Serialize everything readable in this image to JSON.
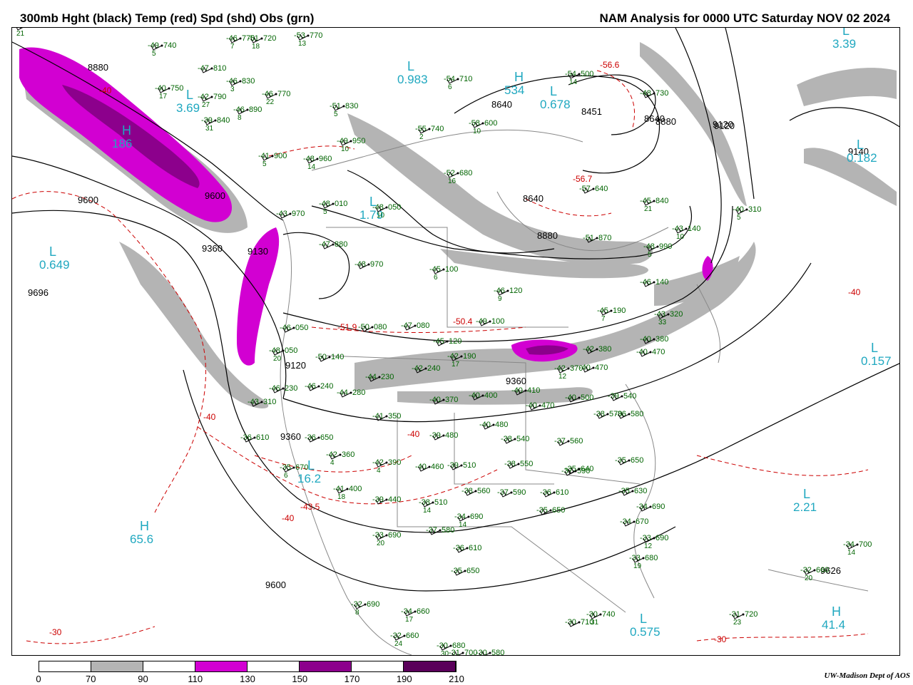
{
  "header": {
    "left_title": "300mb Hght (black) Temp (red) Spd (shd) Obs (grn)",
    "right_title": "NAM Analysis for 0000 UTC Saturday  NOV 02 2024"
  },
  "colors": {
    "height_contours": "#000000",
    "temperature_contours": "#cc0000",
    "wind_70_90": "#b4b4b4",
    "wind_110_130": "#d200d2",
    "wind_150_170": "#8c008c",
    "wind_190_210": "#5a005a",
    "obs_text": "#006400",
    "pressure_centers": "#20a8c0",
    "map_lines": "#888888"
  },
  "colorbar": {
    "labels": [
      "0",
      "70",
      "90",
      "110",
      "130",
      "150",
      "170",
      "190",
      "210"
    ],
    "segments": [
      {
        "color": "#ffffff"
      },
      {
        "color": "#b4b4b4"
      },
      {
        "color": "#ffffff"
      },
      {
        "color": "#d200d2"
      },
      {
        "color": "#ffffff"
      },
      {
        "color": "#8c008c"
      },
      {
        "color": "#ffffff"
      },
      {
        "color": "#5a005a"
      }
    ]
  },
  "height_labels": [
    "8880",
    "9600",
    "9360",
    "9130",
    "8640",
    "8451",
    "8640",
    "8880",
    "9120",
    "9140",
    "8640",
    "8880",
    "9120",
    "9360",
    "9120",
    "9600",
    "9360",
    "9600",
    "9626",
    "9696"
  ],
  "temperature_labels": [
    "-40",
    "-56.6",
    "-56.7",
    "-50.4",
    "-51.9",
    "-40",
    "-40",
    "-43.5",
    "-40",
    "-30",
    "-30",
    "-40"
  ],
  "pressure_centers": [
    {
      "letter": "L",
      "value": "0.983"
    },
    {
      "letter": "H",
      "value": "534"
    },
    {
      "letter": "L",
      "value": "0.678"
    },
    {
      "letter": "L",
      "value": "3.39"
    },
    {
      "letter": "L",
      "value": "0.182"
    },
    {
      "letter": "L",
      "value": "1.79"
    },
    {
      "letter": "L",
      "value": "0.649"
    },
    {
      "letter": "H",
      "value": "186"
    },
    {
      "letter": "L",
      "value": "0.157"
    },
    {
      "letter": "L",
      "value": "2.21"
    },
    {
      "letter": "L",
      "value": "16.2"
    },
    {
      "letter": "H",
      "value": "65.6"
    },
    {
      "letter": "H",
      "value": "41.4"
    },
    {
      "letter": "L",
      "value": "0.575"
    },
    {
      "letter": "L",
      "value": "3.69"
    }
  ],
  "observations": [
    {
      "temp": "-49",
      "hgt": "740",
      "spd": "5"
    },
    {
      "temp": "-46",
      "hgt": "770",
      "spd": "7"
    },
    {
      "temp": "-51",
      "hgt": "720",
      "spd": "18"
    },
    {
      "temp": "-53",
      "hgt": "770",
      "spd": "13"
    },
    {
      "temp": "-47",
      "hgt": "810",
      "spd": ""
    },
    {
      "temp": "-46",
      "hgt": "830",
      "spd": "3"
    },
    {
      "temp": "-40",
      "hgt": "750",
      "spd": "17"
    },
    {
      "temp": "-42",
      "hgt": "790",
      "spd": "27"
    },
    {
      "temp": "-46",
      "hgt": "770",
      "spd": "22"
    },
    {
      "temp": "-46",
      "hgt": "890",
      "spd": "8"
    },
    {
      "temp": "-39",
      "hgt": "840",
      "spd": "31"
    },
    {
      "temp": "-51",
      "hgt": "830",
      "spd": "5"
    },
    {
      "temp": "-55",
      "hgt": "740",
      "spd": "2"
    },
    {
      "temp": "-54",
      "hgt": "710",
      "spd": "6"
    },
    {
      "temp": "-58",
      "hgt": "600",
      "spd": "10"
    },
    {
      "temp": "-54",
      "hgt": "500",
      "spd": "14"
    },
    {
      "temp": "-48",
      "hgt": "730",
      "spd": ""
    },
    {
      "temp": "-49",
      "hgt": "950",
      "spd": "10"
    },
    {
      "temp": "-41",
      "hgt": "900",
      "spd": "5"
    },
    {
      "temp": "-48",
      "hgt": "960",
      "spd": "14"
    },
    {
      "temp": "-52",
      "hgt": "680",
      "spd": "16"
    },
    {
      "temp": "-57",
      "hgt": "640",
      "spd": ""
    },
    {
      "temp": "-45",
      "hgt": "840",
      "spd": "21"
    },
    {
      "temp": "-48",
      "hgt": "010",
      "spd": "5"
    },
    {
      "temp": "-48",
      "hgt": "050",
      "spd": "10"
    },
    {
      "temp": "-43",
      "hgt": "970",
      "spd": ""
    },
    {
      "temp": "-40",
      "hgt": "310",
      "spd": "5"
    },
    {
      "temp": "-43",
      "hgt": "140",
      "spd": "10"
    },
    {
      "temp": "-51",
      "hgt": "870",
      "spd": ""
    },
    {
      "temp": "-48",
      "hgt": "990",
      "spd": "5"
    },
    {
      "temp": "-47",
      "hgt": "880",
      "spd": ""
    },
    {
      "temp": "-48",
      "hgt": "970",
      "spd": ""
    },
    {
      "temp": "-45",
      "hgt": "100",
      "spd": "6"
    },
    {
      "temp": "-46",
      "hgt": "120",
      "spd": "9"
    },
    {
      "temp": "-46",
      "hgt": "140",
      "spd": ""
    },
    {
      "temp": "-45",
      "hgt": "190",
      "spd": "7"
    },
    {
      "temp": "-43",
      "hgt": "320",
      "spd": "33"
    },
    {
      "temp": "-49",
      "hgt": "100",
      "spd": ""
    },
    {
      "temp": "-50",
      "hgt": "080",
      "spd": ""
    },
    {
      "temp": "-47",
      "hgt": "080",
      "spd": ""
    },
    {
      "temp": "-46",
      "hgt": "050",
      "spd": ""
    },
    {
      "temp": "-48",
      "hgt": "050",
      "spd": "20"
    },
    {
      "temp": "-50",
      "hgt": "140",
      "spd": ""
    },
    {
      "temp": "-45",
      "hgt": "120",
      "spd": ""
    },
    {
      "temp": "-42",
      "hgt": "190",
      "spd": "17"
    },
    {
      "temp": "-40",
      "hgt": "380",
      "spd": ""
    },
    {
      "temp": "-42",
      "hgt": "380",
      "spd": ""
    },
    {
      "temp": "-40",
      "hgt": "470",
      "spd": ""
    },
    {
      "temp": "-44",
      "hgt": "230",
      "spd": ""
    },
    {
      "temp": "-42",
      "hgt": "240",
      "spd": ""
    },
    {
      "temp": "-46",
      "hgt": "230",
      "spd": ""
    },
    {
      "temp": "-46",
      "hgt": "240",
      "spd": ""
    },
    {
      "temp": "-44",
      "hgt": "280",
      "spd": ""
    },
    {
      "temp": "-43",
      "hgt": "310",
      "spd": ""
    },
    {
      "temp": "-40",
      "hgt": "370",
      "spd": ""
    },
    {
      "temp": "-40",
      "hgt": "400",
      "spd": ""
    },
    {
      "temp": "-40",
      "hgt": "410",
      "spd": ""
    },
    {
      "temp": "-40",
      "hgt": "470",
      "spd": ""
    },
    {
      "temp": "-42",
      "hgt": "370",
      "spd": "12"
    },
    {
      "temp": "-40",
      "hgt": "470",
      "spd": ""
    },
    {
      "temp": "-40",
      "hgt": "500",
      "spd": ""
    },
    {
      "temp": "-39",
      "hgt": "540",
      "spd": ""
    },
    {
      "temp": "-38",
      "hgt": "570",
      "spd": ""
    },
    {
      "temp": "-41",
      "hgt": "350",
      "spd": ""
    },
    {
      "temp": "-40",
      "hgt": "480",
      "spd": ""
    },
    {
      "temp": "-39",
      "hgt": "480",
      "spd": ""
    },
    {
      "temp": "-38",
      "hgt": "540",
      "spd": ""
    },
    {
      "temp": "-37",
      "hgt": "560",
      "spd": ""
    },
    {
      "temp": "-36",
      "hgt": "580",
      "spd": ""
    },
    {
      "temp": "-36",
      "hgt": "610",
      "spd": ""
    },
    {
      "temp": "-36",
      "hgt": "650",
      "spd": ""
    },
    {
      "temp": "-42",
      "hgt": "360",
      "spd": "4"
    },
    {
      "temp": "-42",
      "hgt": "390",
      "spd": "4"
    },
    {
      "temp": "-40",
      "hgt": "460",
      "spd": ""
    },
    {
      "temp": "-39",
      "hgt": "510",
      "spd": ""
    },
    {
      "temp": "-38",
      "hgt": "550",
      "spd": ""
    },
    {
      "temp": "-37",
      "hgt": "590",
      "spd": ""
    },
    {
      "temp": "-35",
      "hgt": "640",
      "spd": ""
    },
    {
      "temp": "-35",
      "hgt": "650",
      "spd": ""
    },
    {
      "temp": "-35",
      "hgt": "670",
      "spd": "6"
    },
    {
      "temp": "-41",
      "hgt": "400",
      "spd": "18"
    },
    {
      "temp": "-39",
      "hgt": "440",
      "spd": ""
    },
    {
      "temp": "-38",
      "hgt": "510",
      "spd": "14"
    },
    {
      "temp": "-38",
      "hgt": "560",
      "spd": ""
    },
    {
      "temp": "-37",
      "hgt": "590",
      "spd": ""
    },
    {
      "temp": "-36",
      "hgt": "610",
      "spd": ""
    },
    {
      "temp": "-35",
      "hgt": "630",
      "spd": ""
    },
    {
      "temp": "-34",
      "hgt": "690",
      "spd": ""
    },
    {
      "temp": "-34",
      "hgt": "690",
      "spd": "14"
    },
    {
      "temp": "-35",
      "hgt": "650",
      "spd": ""
    },
    {
      "temp": "-34",
      "hgt": "670",
      "spd": ""
    },
    {
      "temp": "-33",
      "hgt": "690",
      "spd": "12"
    },
    {
      "temp": "-33",
      "hgt": "690",
      "spd": "20"
    },
    {
      "temp": "-37",
      "hgt": "580",
      "spd": ""
    },
    {
      "temp": "-36",
      "hgt": "610",
      "spd": ""
    },
    {
      "temp": "-35",
      "hgt": "650",
      "spd": ""
    },
    {
      "temp": "-33",
      "hgt": "680",
      "spd": "19"
    },
    {
      "temp": "-34",
      "hgt": "700",
      "spd": "14"
    },
    {
      "temp": "-32",
      "hgt": "660",
      "spd": "20"
    },
    {
      "temp": "-32",
      "hgt": "690",
      "spd": "8"
    },
    {
      "temp": "-34",
      "hgt": "660",
      "spd": "17"
    },
    {
      "temp": "-32",
      "hgt": "660",
      "spd": "24"
    },
    {
      "temp": "-30",
      "hgt": "680",
      "spd": "30"
    },
    {
      "temp": "-31",
      "hgt": "700",
      "spd": ""
    },
    {
      "temp": "-30",
      "hgt": "580",
      "spd": ""
    },
    {
      "temp": "-30",
      "hgt": "710",
      "spd": ""
    },
    {
      "temp": "-30",
      "hgt": "740",
      "spd": "31"
    },
    {
      "temp": "-31",
      "hgt": "720",
      "spd": "23"
    },
    {
      "temp": "-30",
      "hgt": "690",
      "spd": "21"
    }
  ],
  "credit": "UW-Madison   Dept of AOS"
}
